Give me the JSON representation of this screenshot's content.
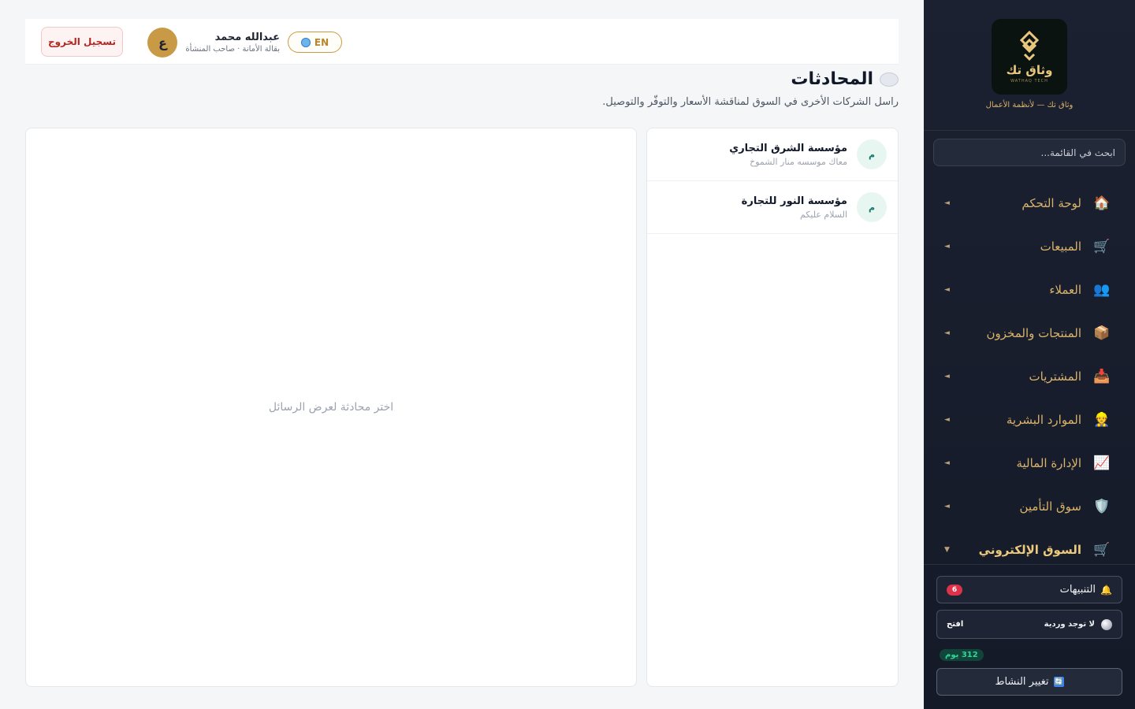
{
  "brand": {
    "logo_text": "وثاق تك",
    "logo_subtext": "WATHAQ TECH",
    "tagline": "وثاق تك — لأنظمة الأعمال"
  },
  "sidebar": {
    "search_placeholder": "ابحث في القائمة...",
    "items": [
      {
        "label": "لوحة التحكم",
        "icon": "home-icon",
        "glyph": "🏠",
        "expanded": false
      },
      {
        "label": "المبيعات",
        "icon": "cart-icon",
        "glyph": "🛒",
        "expanded": false
      },
      {
        "label": "العملاء",
        "icon": "users-icon",
        "glyph": "👥",
        "expanded": false
      },
      {
        "label": "المنتجات والمخزون",
        "icon": "box-icon",
        "glyph": "📦",
        "expanded": false
      },
      {
        "label": "المشتريات",
        "icon": "inbox-icon",
        "glyph": "📥",
        "expanded": false
      },
      {
        "label": "الموارد البشرية",
        "icon": "person-icon",
        "glyph": "👷",
        "expanded": false
      },
      {
        "label": "الإدارة المالية",
        "icon": "chart-icon",
        "glyph": "📈",
        "expanded": false
      },
      {
        "label": "سوق التأمين",
        "icon": "shield-icon",
        "glyph": "🛡️",
        "expanded": false
      },
      {
        "label": "السوق الإلكتروني",
        "icon": "cart-icon",
        "glyph": "🛒",
        "expanded": true
      }
    ],
    "chevron_collapsed": "◄",
    "chevron_expanded": "▼",
    "notifications": {
      "label": "التنبيهات",
      "count": "6"
    },
    "shift": {
      "status": "لا توجد وردية",
      "open_label": "افتح"
    },
    "days_badge": "312 يوم",
    "change_activity": "تغيير النشاط",
    "change_activity_glyph": "🔄"
  },
  "header": {
    "user_name": "عبدالله محمد",
    "user_role": "بقالة الأمانة · صاحب المنشأة",
    "avatar_letter": "ع",
    "lang_label": "EN",
    "logout_label": "تسجيل الخروج"
  },
  "page": {
    "title": "المحادثات",
    "subtitle": "راسل الشركات الأخرى في السوق لمناقشة الأسعار والتوفّر والتوصيل."
  },
  "conversations": [
    {
      "name": "مؤسسة الشرق التجاري",
      "preview": "معاك موسسه منار الشموخ",
      "avatar": "م"
    },
    {
      "name": "مؤسسة النور للتجارة",
      "preview": "السلام عليكم",
      "avatar": "م"
    }
  ],
  "messages": {
    "empty_text": "اختر محادثة لعرض الرسائل"
  },
  "colors": {
    "sidebar_bg": "#1b2130",
    "accent_gold": "#d9b36a",
    "logout_red": "#b3261e",
    "badge_red": "#e0314a",
    "days_green": "#34d399"
  }
}
